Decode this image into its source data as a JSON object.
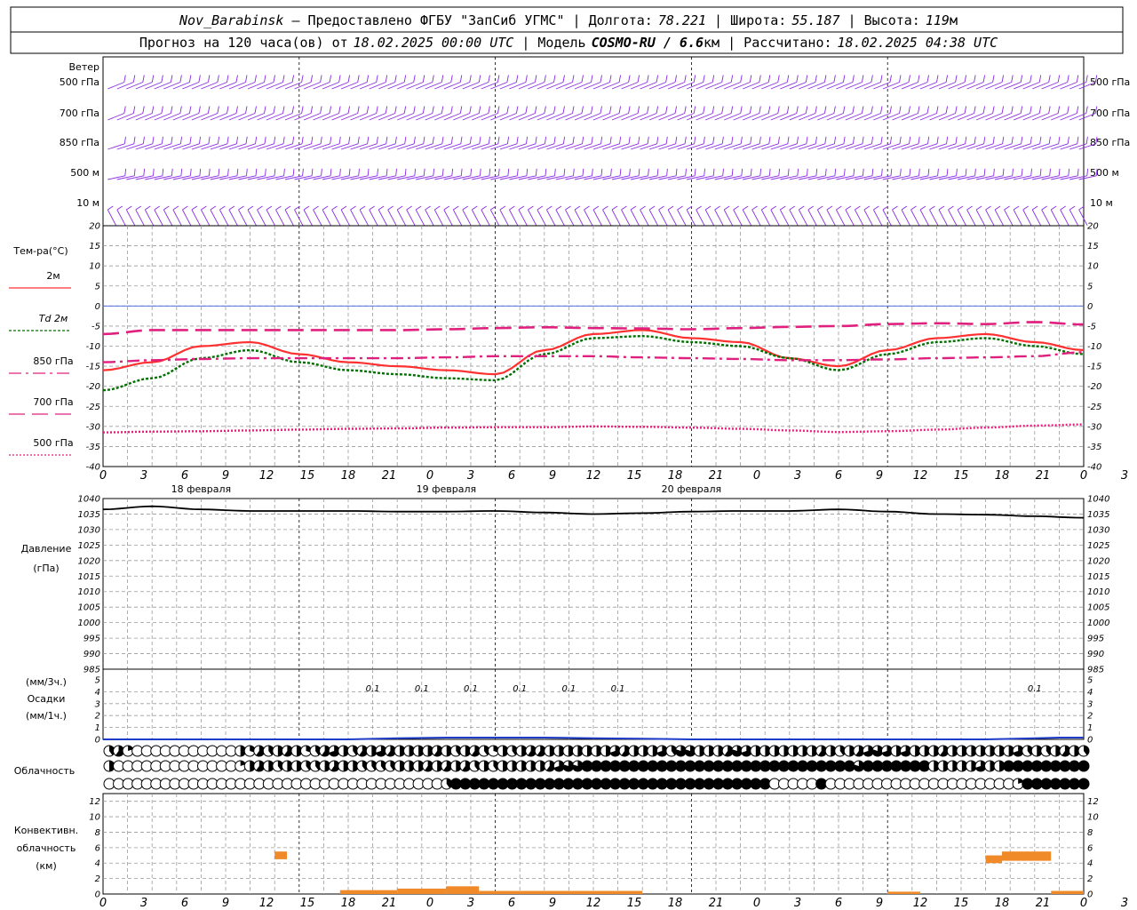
{
  "header": {
    "line1": {
      "station": "Nov_Barabinsk",
      "provider": " – Предоставлено ФГБУ \"ЗапСиб УГМС\" | Долгота:",
      "lon": "78.221",
      "lat_label": " | Широта:",
      "lat": "55.187",
      "alt_label": " | Высота:",
      "alt": "119",
      "alt_unit": "м"
    },
    "line2": {
      "prefix": "Прогноз на 120 часа(ов) от",
      "start": "18.02.2025 00:00 UTC",
      "model_label": " | Модель",
      "model": "COSMO-RU / 6.6",
      "model_unit": "км",
      "calc_label": " | Рассчитано:",
      "calc": "18.02.2025 04:38 UTC"
    }
  },
  "colors": {
    "wind": "#8a2be2",
    "t2m": "#ff3030",
    "td2m": "#007000",
    "t850": "#e0207f",
    "t700": "#e0207f",
    "t500": "#e0207f",
    "pressure": "#000000",
    "precip": "#1e3cc8",
    "conv": "#f08a28"
  },
  "x_axis": {
    "hour_labels": [
      "0",
      "3",
      "6",
      "9",
      "12",
      "15",
      "18",
      "21",
      "0",
      "3",
      "6",
      "9",
      "12",
      "15",
      "18",
      "21",
      "0",
      "3",
      "6",
      "9",
      "12",
      "15",
      "18",
      "21",
      "0",
      "3",
      "6"
    ],
    "day_labels": [
      "18 февраля",
      "19 февраля",
      "20 февраля"
    ]
  },
  "wind_panel": {
    "title": "Ветер",
    "levels": [
      "500 гПа",
      "700 гПа",
      "850 гПа",
      "500 м",
      "10  м"
    ]
  },
  "temp_panel": {
    "title": "Тем-ра(°C)",
    "legend": [
      {
        "key": "t2m",
        "label": "2м",
        "style": "solid"
      },
      {
        "key": "td2m",
        "label": "Td 2м",
        "style": "dotted"
      },
      {
        "key": "t850",
        "label": "850 гПа",
        "style": "dashdot"
      },
      {
        "key": "t700",
        "label": "700 гПа",
        "style": "dash"
      },
      {
        "key": "t500",
        "label": "500 гПа",
        "style": "dot"
      }
    ],
    "y_ticks": [
      "20",
      "15",
      "10",
      "5",
      "0",
      "-5",
      "-10",
      "-15",
      "-20",
      "-25",
      "-30",
      "-35",
      "-40"
    ]
  },
  "pressure_panel": {
    "title_line1": "Давление",
    "title_line2": "(гПа)",
    "y_ticks": [
      "1040",
      "1035",
      "1030",
      "1025",
      "1020",
      "1015",
      "1010",
      "1005",
      "1000",
      "995",
      "990",
      "985"
    ]
  },
  "precip_panel": {
    "title_line1": "(мм/3ч.)",
    "title_line2": "Осадки",
    "title_line3": "(мм/1ч.)",
    "y_ticks": [
      "5",
      "4",
      "3",
      "2",
      "1",
      "0"
    ],
    "annotations": [
      {
        "hour": 33,
        "text": "0.1"
      },
      {
        "hour": 39,
        "text": "0.1"
      },
      {
        "hour": 45,
        "text": "0.1"
      },
      {
        "hour": 51,
        "text": "0.1"
      },
      {
        "hour": 57,
        "text": "0.1"
      },
      {
        "hour": 63,
        "text": "0.1"
      },
      {
        "hour": 114,
        "text": "0.1"
      }
    ]
  },
  "cloud_panel": {
    "title": "Облачность"
  },
  "conv_panel": {
    "title_line1": "Конвективн.",
    "title_line2": "облачность",
    "title_line3": "(км)",
    "y_ticks": [
      "12",
      "10",
      "8",
      "6",
      "4",
      "2",
      "0"
    ]
  },
  "chart_data": [
    {
      "type": "line",
      "name": "wind",
      "x_unit": "hours",
      "levels": [
        "500 гПа",
        "700 гПа",
        "850 гПа",
        "500 м",
        "10  м"
      ],
      "barb_angle_deg": [
        -22,
        -22,
        -18,
        -12,
        62
      ],
      "barb_count_per_level": 105
    },
    {
      "type": "line",
      "name": "temperature",
      "x": [
        0,
        6,
        12,
        18,
        24,
        30,
        36,
        42,
        48,
        54,
        60,
        66,
        72,
        78,
        84,
        90,
        96,
        102,
        108,
        114,
        120
      ],
      "ylim": [
        -40,
        20
      ],
      "series": [
        {
          "name": "2м",
          "key": "t2m",
          "values": [
            -16,
            -14,
            -10,
            -9,
            -12,
            -14,
            -15,
            -16,
            -17,
            -11,
            -7,
            -6,
            -8,
            -9,
            -13,
            -15,
            -11,
            -8,
            -7,
            -9,
            -11
          ]
        },
        {
          "name": "Td 2м",
          "key": "td2m",
          "values": [
            -21,
            -18,
            -13,
            -11,
            -14,
            -16,
            -17,
            -18,
            -18.5,
            -12,
            -8,
            -7.5,
            -9,
            -10,
            -13,
            -16,
            -12,
            -9,
            -8,
            -10,
            -12
          ]
        },
        {
          "name": "850 гПа",
          "key": "t850",
          "values": [
            -14,
            -13.5,
            -13.2,
            -13,
            -13,
            -13,
            -13,
            -12.8,
            -12.5,
            -12.5,
            -12.5,
            -12.8,
            -13,
            -13.2,
            -13.5,
            -13.5,
            -13.3,
            -13,
            -12.8,
            -12.5,
            -11.5
          ]
        },
        {
          "name": "700 гПа",
          "key": "t700",
          "values": [
            -7,
            -6,
            -6,
            -6,
            -6,
            -6,
            -6,
            -5.8,
            -5.5,
            -5.3,
            -5.5,
            -5.6,
            -5.8,
            -5.5,
            -5.2,
            -5,
            -4.5,
            -4.3,
            -4.5,
            -4,
            -4.6
          ]
        },
        {
          "name": "500 гПа",
          "key": "t500",
          "values": [
            -31.5,
            -31.3,
            -31.2,
            -31,
            -30.8,
            -30.6,
            -30.5,
            -30.3,
            -30.2,
            -30.2,
            -30,
            -30.1,
            -30.3,
            -30.6,
            -31,
            -31.4,
            -31.2,
            -30.8,
            -30.3,
            -29.8,
            -29.5
          ]
        }
      ]
    },
    {
      "type": "line",
      "name": "pressure",
      "x": [
        0,
        6,
        12,
        18,
        24,
        30,
        36,
        42,
        48,
        54,
        60,
        66,
        72,
        78,
        84,
        90,
        96,
        102,
        108,
        114,
        120
      ],
      "ylim": [
        985,
        1040
      ],
      "values": [
        1036.5,
        1037.5,
        1036.5,
        1036,
        1036,
        1036,
        1035.8,
        1035.8,
        1036,
        1035.5,
        1035,
        1035.3,
        1035.8,
        1036,
        1036,
        1036.5,
        1035.8,
        1035,
        1034.8,
        1034.3,
        1033.8
      ]
    },
    {
      "type": "area",
      "name": "precip",
      "x": [
        0,
        30,
        36,
        42,
        48,
        54,
        60,
        66,
        72,
        78,
        108,
        114,
        117,
        120
      ],
      "ylim": [
        0,
        5
      ],
      "values": [
        0,
        0,
        0.1,
        0.15,
        0.15,
        0.15,
        0.1,
        0.05,
        0,
        0,
        0,
        0.1,
        0.15,
        0.15
      ]
    },
    {
      "type": "table",
      "name": "cloud",
      "rows": 3,
      "columns": 105,
      "fraction_values": [
        [
          0.4,
          0.6,
          0.2,
          0,
          0,
          0,
          0,
          0,
          0,
          0,
          0,
          0,
          0,
          0,
          0.5,
          0.3,
          0.6,
          0.4,
          0.5,
          0.6,
          0.5,
          0.3,
          0.4,
          0.6,
          0.7,
          0.5,
          0.4,
          0.6,
          0.5,
          0.7,
          0.6,
          0.5,
          0.5,
          0.5,
          0.5,
          0.6,
          0.5,
          0.4,
          0.5,
          0.6,
          0.4,
          0.3,
          0.5,
          0.4,
          0.5,
          0.6,
          0.6,
          0.5,
          0.5,
          0.5,
          0.5,
          0.5,
          0.5,
          0.5,
          0.7,
          0.6,
          0.5,
          0.5,
          0.5,
          0.7,
          0.4,
          0.8,
          0.8,
          0.5,
          0.5,
          0.5,
          0.6,
          0.8,
          0.7,
          0.5,
          0.5,
          0.5,
          0.5,
          0.5,
          0.5,
          0.5,
          0.6,
          0.5,
          0.4,
          0.5,
          0.6,
          0.7,
          0.8,
          0.7,
          0.5,
          0.7,
          0.5,
          0.5,
          0.5,
          0.6,
          0.5,
          0.5,
          0.5,
          0.5,
          0.5,
          0.5,
          0.5,
          0.7,
          0.4,
          0.5,
          0.4,
          0.5,
          0.6,
          0.5,
          0.4
        ],
        [
          0.5,
          0,
          0,
          0,
          0,
          0,
          0,
          0,
          0,
          0,
          0,
          0,
          0,
          0,
          0.2,
          0.5,
          0.6,
          0.5,
          0.4,
          0.5,
          0.5,
          0.4,
          0.4,
          0.5,
          0.6,
          0.5,
          0.5,
          0.4,
          0.4,
          0.4,
          0.4,
          0.5,
          0.5,
          0.5,
          0.6,
          0.5,
          0.6,
          0.5,
          0.6,
          0.4,
          0.5,
          0.4,
          0.5,
          0.5,
          0.5,
          0.5,
          0.5,
          0.6,
          0.7,
          0.8,
          0.8,
          1,
          1,
          1,
          1,
          1,
          1,
          1,
          1,
          1,
          1,
          1,
          1,
          1,
          1,
          1,
          1,
          1,
          1,
          1,
          1,
          1,
          1,
          1,
          1,
          1,
          1,
          1,
          1,
          1,
          0.8,
          1,
          1,
          1,
          1,
          1,
          1,
          1,
          0.5,
          0.5,
          0.5,
          0.5,
          0.5,
          0.7,
          0.5,
          0.5,
          1,
          1,
          1,
          1,
          1,
          1,
          1,
          1,
          1
        ],
        [
          0,
          0,
          0,
          0,
          0,
          0,
          0,
          0,
          0,
          0,
          0,
          0,
          0,
          0,
          0,
          0,
          0,
          0,
          0,
          0,
          0,
          0,
          0,
          0,
          0,
          0,
          0,
          0,
          0,
          0,
          0,
          0,
          0,
          0,
          0,
          0,
          0.4,
          1,
          1,
          1,
          1,
          1,
          1,
          1,
          1,
          1,
          1,
          1,
          1,
          1,
          1,
          1,
          1,
          1,
          1,
          1,
          1,
          1,
          1,
          1,
          1,
          1,
          1,
          1,
          1,
          1,
          1,
          1,
          1,
          1,
          1,
          0,
          0,
          0,
          0,
          0,
          1,
          0,
          0,
          0,
          0,
          0,
          0,
          0,
          0,
          0,
          0,
          0,
          0,
          0,
          0,
          0,
          0,
          0,
          0,
          0,
          0,
          0.2,
          1,
          1,
          1,
          1,
          1,
          1,
          1
        ]
      ]
    },
    {
      "type": "bar",
      "name": "convective_cloud",
      "x_unit": "hours",
      "ylim": [
        0,
        13
      ],
      "bars": [
        {
          "x0": 21,
          "x1": 22.5,
          "bottom": 4.5,
          "top": 5.5
        },
        {
          "x0": 29,
          "x1": 36,
          "bottom": 0,
          "top": 0.5
        },
        {
          "x0": 36,
          "x1": 42,
          "bottom": 0,
          "top": 0.7
        },
        {
          "x0": 42,
          "x1": 46,
          "bottom": 0,
          "top": 1
        },
        {
          "x0": 46,
          "x1": 66,
          "bottom": 0,
          "top": 0.4
        },
        {
          "x0": 96,
          "x1": 100,
          "bottom": 0,
          "top": 0.3
        },
        {
          "x0": 116,
          "x1": 120,
          "bottom": 0,
          "top": 0.4
        },
        {
          "x0": 108,
          "x1": 110,
          "bottom": 4,
          "top": 5
        },
        {
          "x0": 110,
          "x1": 116,
          "bottom": 4.3,
          "top": 5.5
        }
      ]
    }
  ]
}
